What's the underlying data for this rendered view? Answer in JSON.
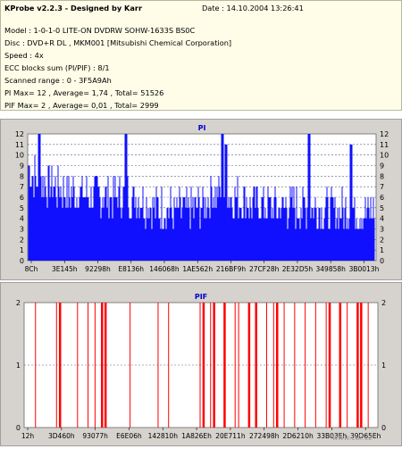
{
  "header": {
    "title": "KProbe v2.2.3 - Designed by Karr",
    "date": "Date : 14.10.2004 13:26:41",
    "model": "Model : 1-0-1-0 LITE-ON DVDRW SOHW-1633S BS0C",
    "disc": "Disc : DVD+R DL , MKM001 [Mitsubishi Chemical Corporation]",
    "speed": "Speed : 4x",
    "ecc": "ECC blocks sum (PI/PIF) : 8/1",
    "range": "Scanned range : 0 - 3F5A9Ah",
    "pi_stats": "PI Max= 12 , Average= 1,74 , Total= 51526",
    "pif_stats": "PIF Max= 2 , Average= 0,01 , Total= 2999"
  },
  "watermark": "www.cdr.cz",
  "colors": {
    "pi": "#1010ff",
    "pif": "#ff0000",
    "panel": "#d6d3ce",
    "plot": "#ffffff",
    "title": "#0000cc"
  },
  "chart_data": [
    {
      "type": "bar",
      "title": "PI",
      "ylim": [
        0,
        12
      ],
      "yticks": [
        "12",
        "11",
        "10",
        "9",
        "8",
        "7",
        "6",
        "5",
        "4",
        "3",
        "2",
        "1",
        "0"
      ],
      "xticks": [
        "8Ch",
        "3E145h",
        "92298h",
        "E8136h",
        "146068h",
        "1AE562h",
        "216BF9h",
        "27CF28h",
        "2E32D5h",
        "349858h",
        "3B0013h"
      ],
      "profile": {
        "base": [
          [
            0,
            8
          ],
          [
            0.03,
            7
          ],
          [
            0.1,
            6
          ],
          [
            0.2,
            5.5
          ],
          [
            0.3,
            5.5
          ],
          [
            0.35,
            4.5
          ],
          [
            0.45,
            4
          ],
          [
            0.5,
            4.5
          ],
          [
            0.53,
            6
          ],
          [
            0.58,
            5.5
          ],
          [
            0.62,
            5
          ],
          [
            0.7,
            4.5
          ],
          [
            0.8,
            4.5
          ],
          [
            0.9,
            4
          ],
          [
            1,
            4
          ]
        ],
        "max": 12,
        "spikes": [
          [
            0.03,
            12
          ],
          [
            0.28,
            12
          ],
          [
            0.56,
            12
          ],
          [
            0.57,
            11
          ],
          [
            0.81,
            12
          ],
          [
            0.93,
            11
          ]
        ]
      }
    },
    {
      "type": "bar",
      "title": "PIF",
      "ylim": [
        0,
        2
      ],
      "yticks": [
        "2",
        "1",
        "0"
      ],
      "xticks": [
        "12h",
        "3D460h",
        "93077h",
        "E6E06h",
        "142810h",
        "1A826Eh",
        "20E711h",
        "272498h",
        "2D6210h",
        "33B03Eh",
        "39D65Eh"
      ],
      "events": [
        0.03,
        0.09,
        0.1,
        0.15,
        0.18,
        0.2,
        0.22,
        0.23,
        0.3,
        0.38,
        0.41,
        0.5,
        0.51,
        0.53,
        0.54,
        0.57,
        0.6,
        0.61,
        0.64,
        0.66,
        0.69,
        0.71,
        0.72,
        0.74,
        0.77,
        0.8,
        0.83,
        0.86,
        0.87,
        0.9,
        0.92,
        0.95,
        0.96,
        0.98
      ],
      "tall": [
        0.1,
        0.22,
        0.23,
        0.51,
        0.54,
        0.57,
        0.64,
        0.66,
        0.72,
        0.87,
        0.9,
        0.95,
        0.96
      ]
    }
  ]
}
